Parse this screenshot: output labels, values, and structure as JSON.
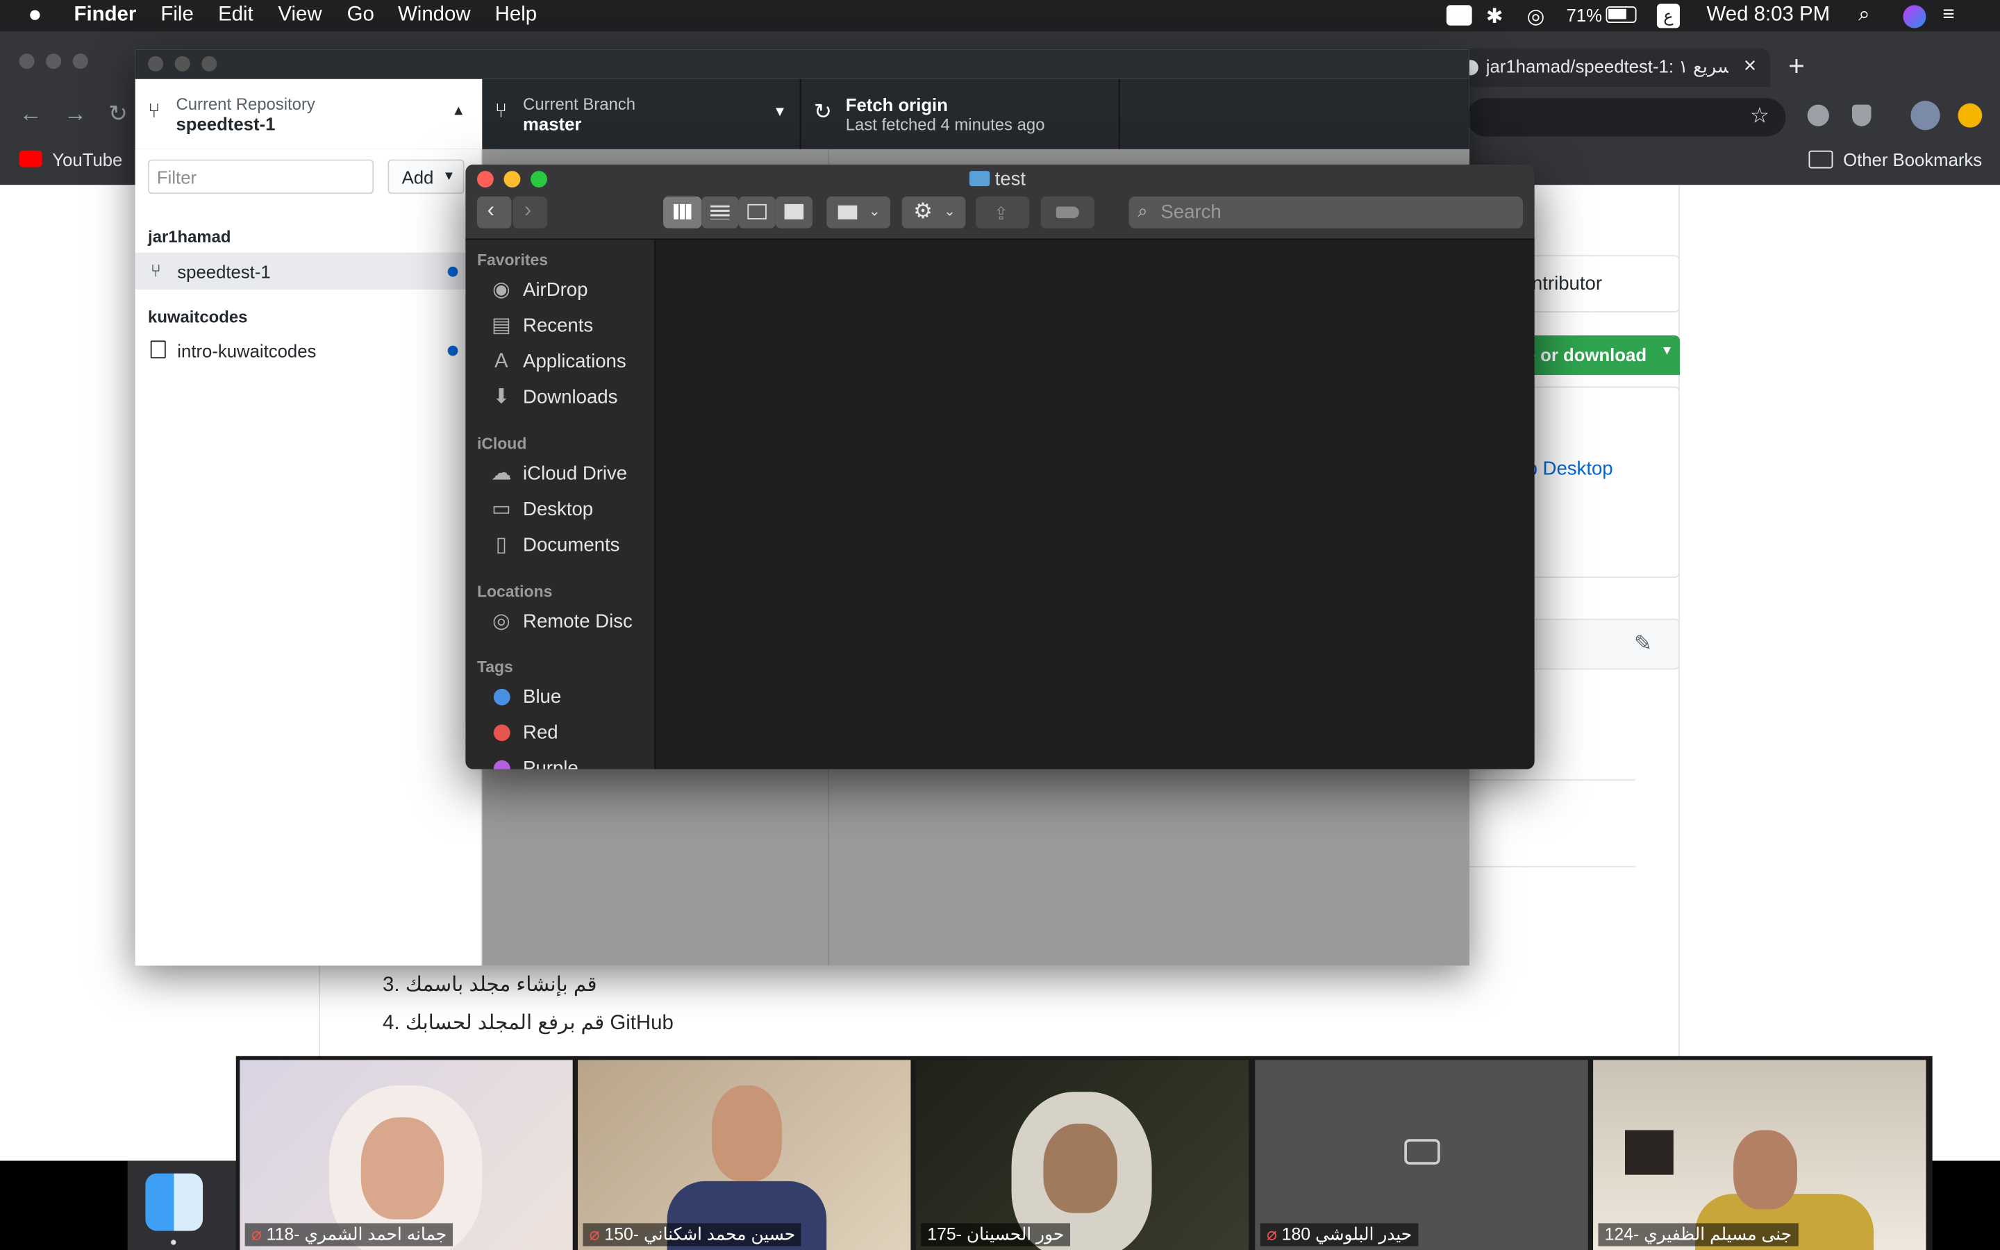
{
  "menubar": {
    "app": "Finder",
    "items": [
      "File",
      "Edit",
      "View",
      "Go",
      "Window",
      "Help"
    ],
    "battery": "71%",
    "input_source": "ع",
    "clock": "Wed 8:03 PM"
  },
  "browser": {
    "tab_title": "jar1hamad/speedtest-1: سريع ١",
    "bookmark_youtube": "YouTube",
    "bookmark_other": "Other Bookmarks"
  },
  "github_page": {
    "contributor_text": "ntributor",
    "clone_button": "e or download",
    "open_desktop": "b Desktop",
    "step3": "قم بإنشاء مجلد باسمك",
    "step3_num": "3.",
    "step4": "قم برفع المجلد لحسابك GitHub",
    "step4_num": "4."
  },
  "github_desktop": {
    "repo_label": "Current Repository",
    "repo_value": "speedtest-1",
    "branch_label": "Current Branch",
    "branch_value": "master",
    "fetch_label": "Fetch origin",
    "fetch_sub": "Last fetched 4 minutes ago",
    "filter_placeholder": "Filter",
    "add_label": "Add",
    "groups": [
      {
        "name": "jar1hamad",
        "repo": "speedtest-1"
      },
      {
        "name": "kuwaitcodes",
        "repo": "intro-kuwaitcodes"
      }
    ]
  },
  "finder": {
    "title": "test",
    "search_placeholder": "Search",
    "favorites_label": "Favorites",
    "favorites": [
      "AirDrop",
      "Recents",
      "Applications",
      "Downloads"
    ],
    "icloud_label": "iCloud",
    "icloud": [
      "iCloud Drive",
      "Desktop",
      "Documents"
    ],
    "locations_label": "Locations",
    "locations": [
      "Remote Disc"
    ],
    "tags_label": "Tags",
    "tags": [
      "Blue",
      "Red",
      "Purple"
    ]
  },
  "zoom": {
    "participants": [
      "118- جمانه احمد الشمري",
      "150- حسين محمد اشكناني",
      "175- حور الحسينان",
      "180 حيدر البلوشي",
      "124- جنى مسيلم الظفيري"
    ]
  },
  "colors": {
    "tag_blue": "#4a90e2",
    "tag_red": "#e8544e",
    "tag_purple": "#b460e0",
    "accent": "#0366d6",
    "gh_green": "#2ea44f"
  }
}
